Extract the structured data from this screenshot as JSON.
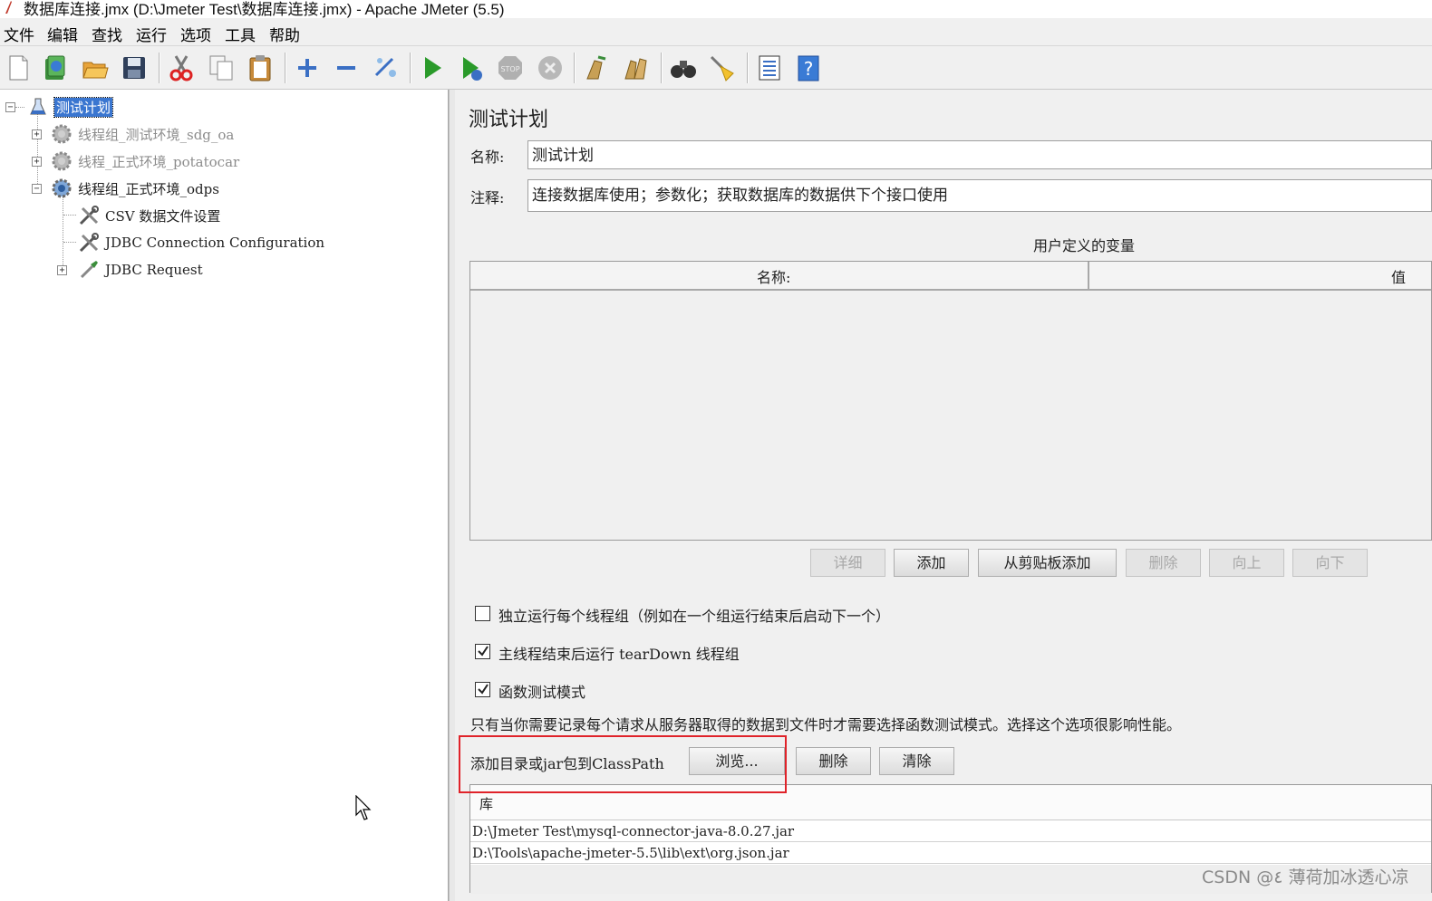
{
  "window": {
    "title": "数据库连接.jmx (D:\\Jmeter Test\\数据库连接.jmx) - Apache JMeter (5.5)"
  },
  "menu": [
    "文件",
    "编辑",
    "查找",
    "运行",
    "选项",
    "工具",
    "帮助"
  ],
  "toolbar": {
    "icons": [
      "new-icon",
      "templates-icon",
      "open-icon",
      "save-icon",
      "cut-icon",
      "copy-icon",
      "paste-icon",
      "expand-icon",
      "collapse-icon",
      "toggle-icon",
      "start-icon",
      "start-no-pause-icon",
      "stop-icon",
      "shutdown-icon",
      "clear-icon",
      "clear-all-icon",
      "search-icon",
      "reset-search-icon",
      "function-helper-icon",
      "help-icon"
    ]
  },
  "tree": {
    "root": "测试计划",
    "items": [
      {
        "label": "线程组_测试环境_sdg_oa",
        "disabled": true
      },
      {
        "label": "线程_正式环境_potatocar",
        "disabled": true
      },
      {
        "label": "线程组_正式环境_odps",
        "disabled": false
      },
      {
        "label": "CSV 数据文件设置"
      },
      {
        "label": "JDBC Connection Configuration"
      },
      {
        "label": "JDBC Request"
      }
    ]
  },
  "panel": {
    "title": "测试计划",
    "name_label": "名称:",
    "name_value": "测试计划",
    "comment_label": "注释:",
    "comment_value": "连接数据库使用；参数化；获取数据库的数据供下个接口使用"
  },
  "vars": {
    "caption": "用户定义的变量",
    "col_name": "名称:",
    "col_value": "值",
    "buttons": {
      "detail": "详细",
      "add": "添加",
      "add_clipboard": "从剪贴板添加",
      "delete": "删除",
      "up": "向上",
      "down": "向下"
    }
  },
  "options": {
    "serialize": {
      "label": "独立运行每个线程组（例如在一个组运行结束后启动下一个）",
      "checked": false
    },
    "teardown": {
      "label": "主线程结束后运行 tearDown 线程组",
      "checked": true
    },
    "functional": {
      "label": "函数测试模式",
      "checked": true
    },
    "note": "只有当你需要记录每个请求从服务器取得的数据到文件时才需要选择函数测试模式。选择这个选项很影响性能。"
  },
  "classpath": {
    "label": "添加目录或jar包到ClassPath",
    "browse": "浏览...",
    "delete": "删除",
    "clear": "清除",
    "lib_header": "库",
    "rows": [
      "D:\\Jmeter Test\\mysql-connector-java-8.0.27.jar",
      "D:\\Tools\\apache-jmeter-5.5\\lib\\ext\\org.json.jar"
    ]
  },
  "watermark": "CSDN @٤ 薄荷加冰透心凉",
  "colors": {
    "selection": "#3a76d0",
    "highlight_box": "#e0232a",
    "start_green": "#2a9a2a"
  }
}
